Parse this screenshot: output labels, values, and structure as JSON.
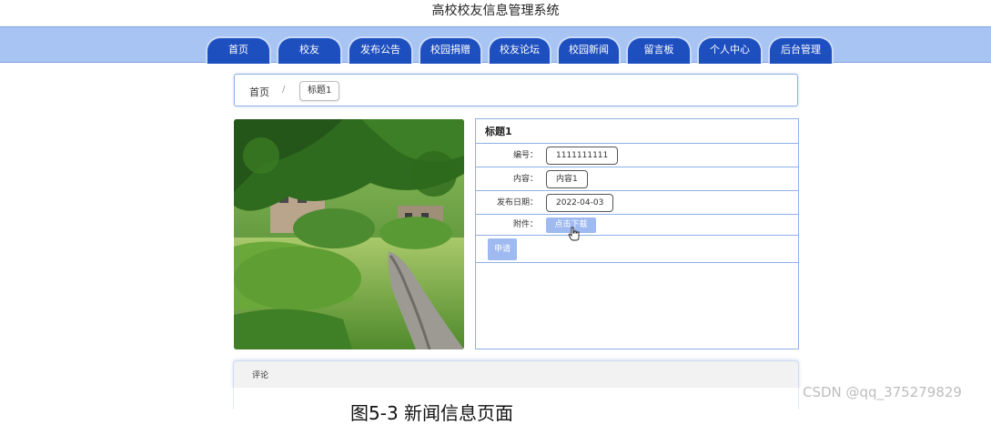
{
  "site": {
    "title": "高校校友信息管理系统"
  },
  "nav": {
    "items": [
      {
        "label": "首页"
      },
      {
        "label": "校友"
      },
      {
        "label": "发布公告"
      },
      {
        "label": "校园捐赠"
      },
      {
        "label": "校友论坛"
      },
      {
        "label": "校园新闻"
      },
      {
        "label": "留言板"
      },
      {
        "label": "个人中心"
      },
      {
        "label": "后台管理"
      }
    ]
  },
  "breadcrumb": {
    "home": "首页",
    "separator": "/",
    "current": "标题1"
  },
  "detail": {
    "title": "标题1",
    "fields": [
      {
        "label": "编号：",
        "value": "1111111111"
      },
      {
        "label": "内容：",
        "value": "内容1"
      },
      {
        "label": "发布日期：",
        "value": "2022-04-03"
      },
      {
        "label": "附件：",
        "button": "点击下载"
      }
    ],
    "apply_button": "申请"
  },
  "comments": {
    "label": "评论"
  },
  "caption": "图5-3 新闻信息页面",
  "watermark": "CSDN @qq_375279829",
  "colors": {
    "nav_bar": "#a8c4f3",
    "nav_tab": "#1e4fbf",
    "border": "#8fb0e6",
    "button": "#9fbaf0"
  },
  "icons": {
    "cursor": "hand-pointer-icon"
  }
}
